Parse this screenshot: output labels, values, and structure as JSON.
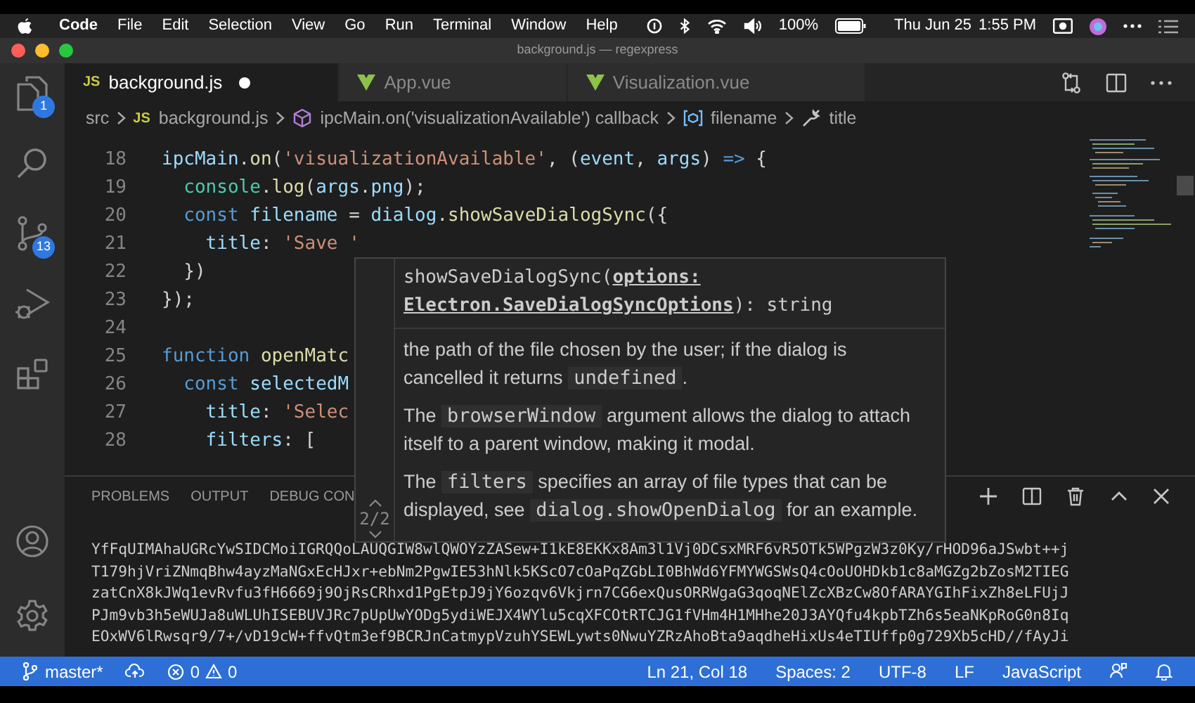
{
  "menubar": {
    "app": "Code",
    "menus": [
      "File",
      "Edit",
      "Selection",
      "View",
      "Go",
      "Run",
      "Terminal",
      "Window",
      "Help"
    ],
    "battery": "100%",
    "date": "Thu Jun 25",
    "time": "1:55 PM"
  },
  "window": {
    "title": "background.js — regexpress"
  },
  "activity_bar": {
    "top": [
      {
        "kind": "explorer",
        "badge": "1"
      },
      {
        "kind": "search"
      },
      {
        "kind": "source-control",
        "badge": "13"
      },
      {
        "kind": "debug"
      },
      {
        "kind": "extensions"
      }
    ],
    "bottom": [
      {
        "kind": "account"
      },
      {
        "kind": "settings"
      }
    ]
  },
  "tabs": [
    {
      "label": "background.js",
      "kind": "js",
      "badge": "JS",
      "selected": true,
      "modified": true
    },
    {
      "label": "App.vue",
      "kind": "vue",
      "selected": false,
      "modified": false
    },
    {
      "label": "Visualization.vue",
      "kind": "vue",
      "selected": false,
      "modified": false
    }
  ],
  "breadcrumbs": [
    {
      "label": "src",
      "kind": "folder"
    },
    {
      "label": "background.js",
      "kind": "file",
      "badge": "JS"
    },
    {
      "label": "ipcMain.on('visualizationAvailable') callback",
      "kind": "method"
    },
    {
      "label": "filename",
      "kind": "variable"
    },
    {
      "label": "title",
      "kind": "property"
    }
  ],
  "editor": {
    "lines": [
      {
        "number": "18",
        "tokens": [
          {
            "text": "ipcMain",
            "kind": "var"
          },
          {
            "text": ".",
            "kind": "punct"
          },
          {
            "text": "on",
            "kind": "fn"
          },
          {
            "text": "(",
            "kind": "punct"
          },
          {
            "text": "'visualizationAvailable'",
            "kind": "str"
          },
          {
            "text": ", (",
            "kind": "punct"
          },
          {
            "text": "event",
            "kind": "var"
          },
          {
            "text": ", ",
            "kind": "punct"
          },
          {
            "text": "args",
            "kind": "var"
          },
          {
            "text": ") ",
            "kind": "punct"
          },
          {
            "text": "=>",
            "kind": "kw"
          },
          {
            "text": " {",
            "kind": "punct"
          }
        ]
      },
      {
        "number": "19",
        "tokens": [
          {
            "text": "  console",
            "kind": "obj"
          },
          {
            "text": ".",
            "kind": "punct"
          },
          {
            "text": "log",
            "kind": "fn"
          },
          {
            "text": "(",
            "kind": "punct"
          },
          {
            "text": "args",
            "kind": "var"
          },
          {
            "text": ".",
            "kind": "punct"
          },
          {
            "text": "png",
            "kind": "var"
          },
          {
            "text": ");",
            "kind": "punct"
          }
        ]
      },
      {
        "number": "20",
        "tokens": [
          {
            "text": "  const",
            "kind": "kw"
          },
          {
            "text": " filename",
            "kind": "var"
          },
          {
            "text": " = ",
            "kind": "punct"
          },
          {
            "text": "dialog",
            "kind": "var"
          },
          {
            "text": ".",
            "kind": "punct"
          },
          {
            "text": "showSaveDialogSync",
            "kind": "fn"
          },
          {
            "text": "({",
            "kind": "punct"
          }
        ]
      },
      {
        "number": "21",
        "tokens": [
          {
            "text": "    title",
            "kind": "var"
          },
          {
            "text": ": ",
            "kind": "punct"
          },
          {
            "text": "'Save '",
            "kind": "str"
          }
        ]
      },
      {
        "number": "22",
        "tokens": [
          {
            "text": "  })",
            "kind": "punct"
          }
        ]
      },
      {
        "number": "23",
        "tokens": [
          {
            "text": "});",
            "kind": "punct"
          }
        ]
      },
      {
        "number": "24"
      },
      {
        "number": "25",
        "tokens": [
          {
            "text": "function",
            "kind": "kw"
          },
          {
            "text": " openMatc",
            "kind": "fn"
          }
        ]
      },
      {
        "number": "26",
        "tokens": [
          {
            "text": "  const",
            "kind": "kw"
          },
          {
            "text": " selectedM",
            "kind": "var"
          }
        ]
      },
      {
        "number": "27",
        "tokens": [
          {
            "text": "    title",
            "kind": "var"
          },
          {
            "text": ": ",
            "kind": "punct"
          },
          {
            "text": "'Selec",
            "kind": "str"
          }
        ]
      },
      {
        "number": "28",
        "tokens": [
          {
            "text": "    filters",
            "kind": "var"
          },
          {
            "text": ": [",
            "kind": "punct"
          }
        ]
      }
    ]
  },
  "hover": {
    "signature": "showSaveDialogSync(**options: Electron.SaveDialogSyncOptions**): string",
    "counter": "2/2",
    "paragraphs": [
      [
        {
          "text": "the path of the file chosen by the user; if the dialog is cancelled it returns ",
          "kind": "prose"
        },
        {
          "text": "undefined",
          "kind": "code"
        },
        {
          "text": ".",
          "kind": "prose"
        }
      ],
      [
        {
          "text": "The ",
          "kind": "prose"
        },
        {
          "text": "browserWindow",
          "kind": "code"
        },
        {
          "text": " argument allows the dialog to attach itself to a parent window, making it modal.",
          "kind": "prose"
        }
      ],
      [
        {
          "text": "The ",
          "kind": "prose"
        },
        {
          "text": "filters",
          "kind": "code"
        },
        {
          "text": " specifies an array of file types that can be displayed, see ",
          "kind": "prose"
        },
        {
          "text": "dialog.showOpenDialog",
          "kind": "code"
        },
        {
          "text": " for an example.",
          "kind": "prose"
        }
      ]
    ]
  },
  "panel": {
    "tabs": [
      {
        "label": "PROBLEMS",
        "selected": false
      },
      {
        "label": "OUTPUT",
        "selected": false
      },
      {
        "label": "DEBUG CON",
        "selected": false
      }
    ],
    "terminal_lines": [
      "YfFqUIMAhaUGRcYwSIDCMoiIGRQQoLAUQGIW8wlQWOYzZASew+I1kE8EKKx8Am3l1Vj0DCsxMRF6vR5OTk5WPgzW3z0Ky/rHOD96aJSwbt++j",
      "T179hjVriZNmqBhw4ayzMaNGxEcHJxr+ebNm2PgwIE53hNlk5KScO7cOaPqZGbLI0BhWd6YFMYWGSWsQ4cOoUOHDkb1c8aMGZg2bZosM2TIEG",
      "zatCnX8kJWq1evRvfu3fH6669j9OjRsCRhxd1PgEtpJ9jY6ozqv6Vkjrn7CG6exQusORRWgaG3qoqNElZcXBzCw8OfARAYGIhFixZh8eLFUjJ",
      "PJm9vb3h5eWUJa8uWLUhISEBUVJRc7pUpUwYODg5ydiWEJX4WYlu5cqXFCOtRTCJG1fVHm4H1MHhe20J3AYQfu4kpbTZh6s5eaNKpRoG0n8Iq",
      "EOxWV6lRwsqr9/7+/vD19cW+ffvQtm3ef9BCRJnCatmypVzuhYSEWLywts0NwuYZRzAhoBta9aqdheHixUs4eTIUffp0g729Xb5cHD//fAyJi"
    ]
  },
  "status_bar": {
    "branch": "master*",
    "errors": "0",
    "warnings": "0",
    "items": [
      "Ln 21, Col 18",
      "Spaces: 2",
      "UTF-8",
      "LF",
      "JavaScript"
    ]
  }
}
